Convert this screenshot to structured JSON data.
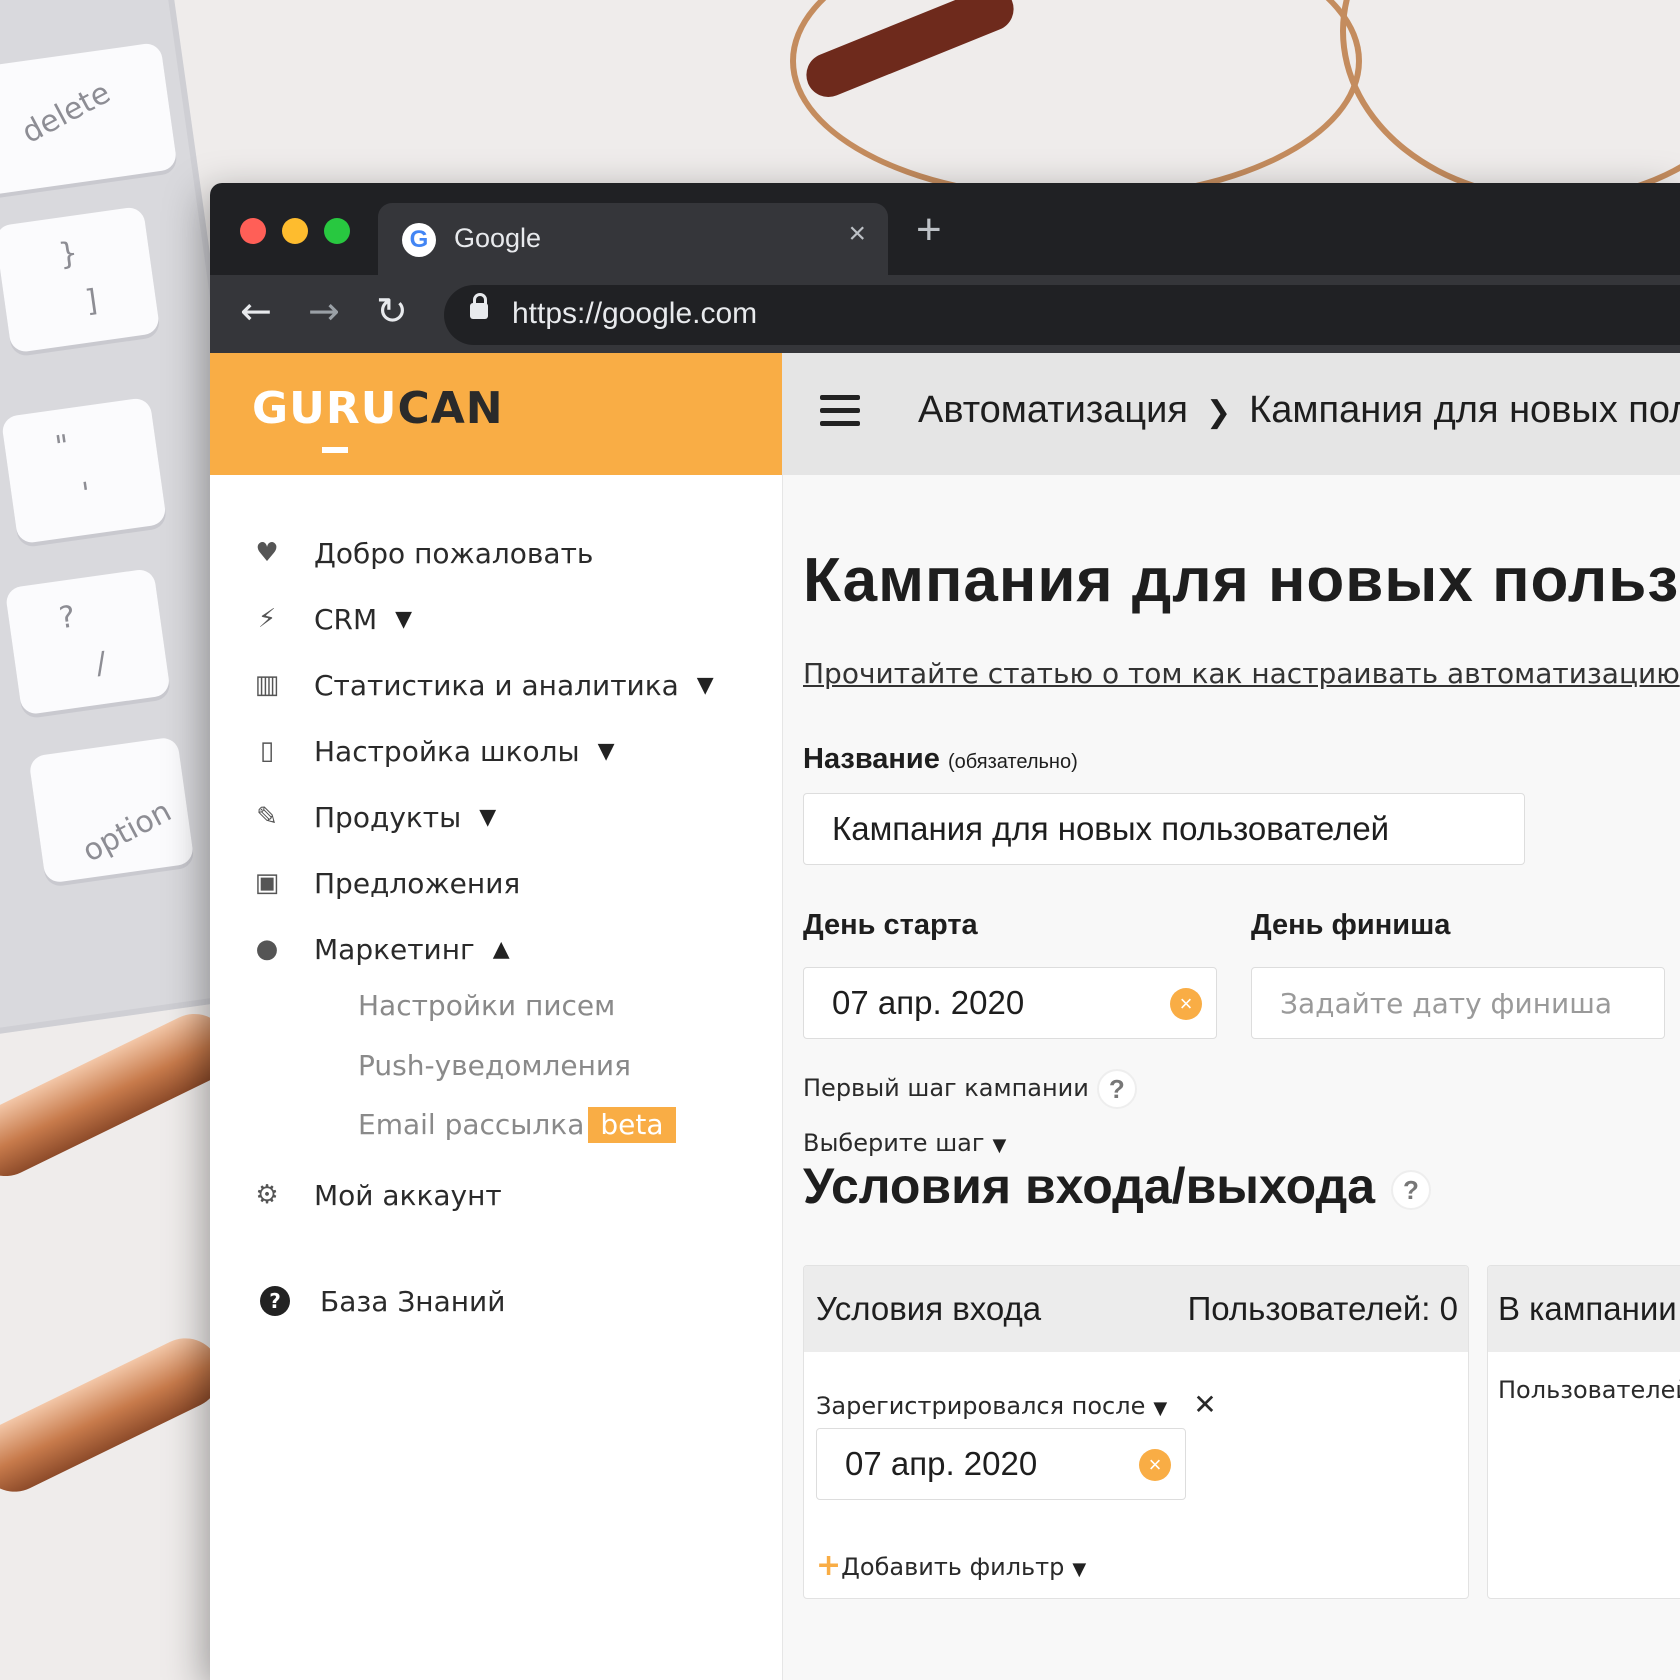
{
  "desk": {
    "keys": [
      "delete",
      "}",
      "]",
      "\"",
      "'",
      "?",
      "/",
      "option"
    ]
  },
  "browser": {
    "tab_title": "Google",
    "tab_close": "×",
    "new_tab": "+",
    "url": "https://google.com",
    "traffic_lights": {
      "close": "#ff5f57",
      "minimize": "#febc2e",
      "maximize": "#28c840"
    }
  },
  "app": {
    "logo": {
      "light": "GURU",
      "dark": "CAN"
    },
    "accent_color": "#f9ad45",
    "breadcrumb": [
      "Автоматизация",
      "Кампания для новых пользователей"
    ],
    "sidebar": {
      "items": [
        {
          "label": "Добро пожаловать",
          "icon": "heart-icon"
        },
        {
          "label": "CRM",
          "icon": "bolt-icon",
          "chevron": "down"
        },
        {
          "label": "Статистика и аналитика",
          "icon": "chart-icon",
          "chevron": "down"
        },
        {
          "label": "Настройка школы",
          "icon": "phone-icon",
          "chevron": "down"
        },
        {
          "label": "Продукты",
          "icon": "pencil-icon",
          "chevron": "down"
        },
        {
          "label": "Предложения",
          "icon": "money-icon"
        },
        {
          "label": "Маркетинг",
          "icon": "chat-icon",
          "chevron": "up"
        }
      ],
      "marketing_sub": [
        "Настройки писем",
        "Push-уведомления",
        "Email рассылка"
      ],
      "beta_badge": "beta",
      "account": {
        "label": "Мой аккаунт",
        "icon": "gear-icon"
      },
      "knowledge": {
        "label": "База Знаний",
        "icon": "question-circle-icon"
      }
    },
    "main": {
      "title": "Кампания для новых пользователей",
      "help_link": "Прочитайте статью о том как настраивать автоматизацию",
      "name_label": "Название",
      "name_required": "(обязательно)",
      "name_value": "Кампания для новых пользователей",
      "start_label": "День старта",
      "start_value": "07 апр. 2020",
      "finish_label": "День финиша",
      "finish_placeholder": "Задайте дату финиша",
      "first_step_label": "Первый шаг кампании",
      "first_step_select": "Выберите шаг",
      "conditions_title": "Условия входа/выхода",
      "entry_card": {
        "title": "Условия входа",
        "users": "Пользователей: 0",
        "filter_label": "Зарегистрировался после",
        "filter_value": "07 апр. 2020",
        "add_filter": "Добавить фильтр"
      },
      "in_campaign_card": {
        "title": "В кампании",
        "users": "Пользователей"
      }
    }
  }
}
